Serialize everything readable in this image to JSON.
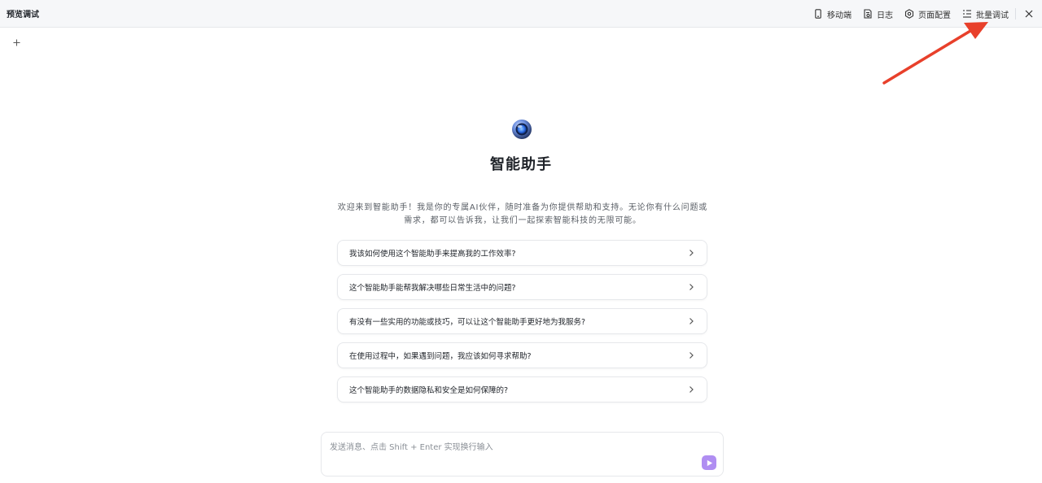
{
  "header": {
    "title": "预览调试",
    "actions": [
      {
        "label": "移动端",
        "icon": "mobile-icon"
      },
      {
        "label": "日志",
        "icon": "log-icon"
      },
      {
        "label": "页面配置",
        "icon": "settings-icon"
      },
      {
        "label": "批量调试",
        "icon": "batch-list-icon"
      }
    ],
    "close_icon": "close-icon"
  },
  "new_chat_icon": "plus-icon",
  "assistant": {
    "name": "智能助手",
    "intro": "欢迎来到智能助手！我是你的专属AI伙伴，随时准备为你提供帮助和支持。无论你有什么问题或需求，都可以告诉我，让我们一起探索智能科技的无限可能。"
  },
  "suggestions": [
    "我该如何使用这个智能助手来提高我的工作效率?",
    "这个智能助手能帮我解决哪些日常生活中的问题?",
    "有没有一些实用的功能或技巧，可以让这个智能助手更好地为我服务?",
    "在使用过程中，如果遇到问题，我应该如何寻求帮助?",
    "这个智能助手的数据隐私和安全是如何保障的?"
  ],
  "composer": {
    "value": "",
    "placeholder": "发送消息、点击 Shift + Enter 实现换行输入",
    "send_icon": "send-icon"
  },
  "colors": {
    "accent": "#b08ef2",
    "annotation_arrow": "#e8402b"
  }
}
